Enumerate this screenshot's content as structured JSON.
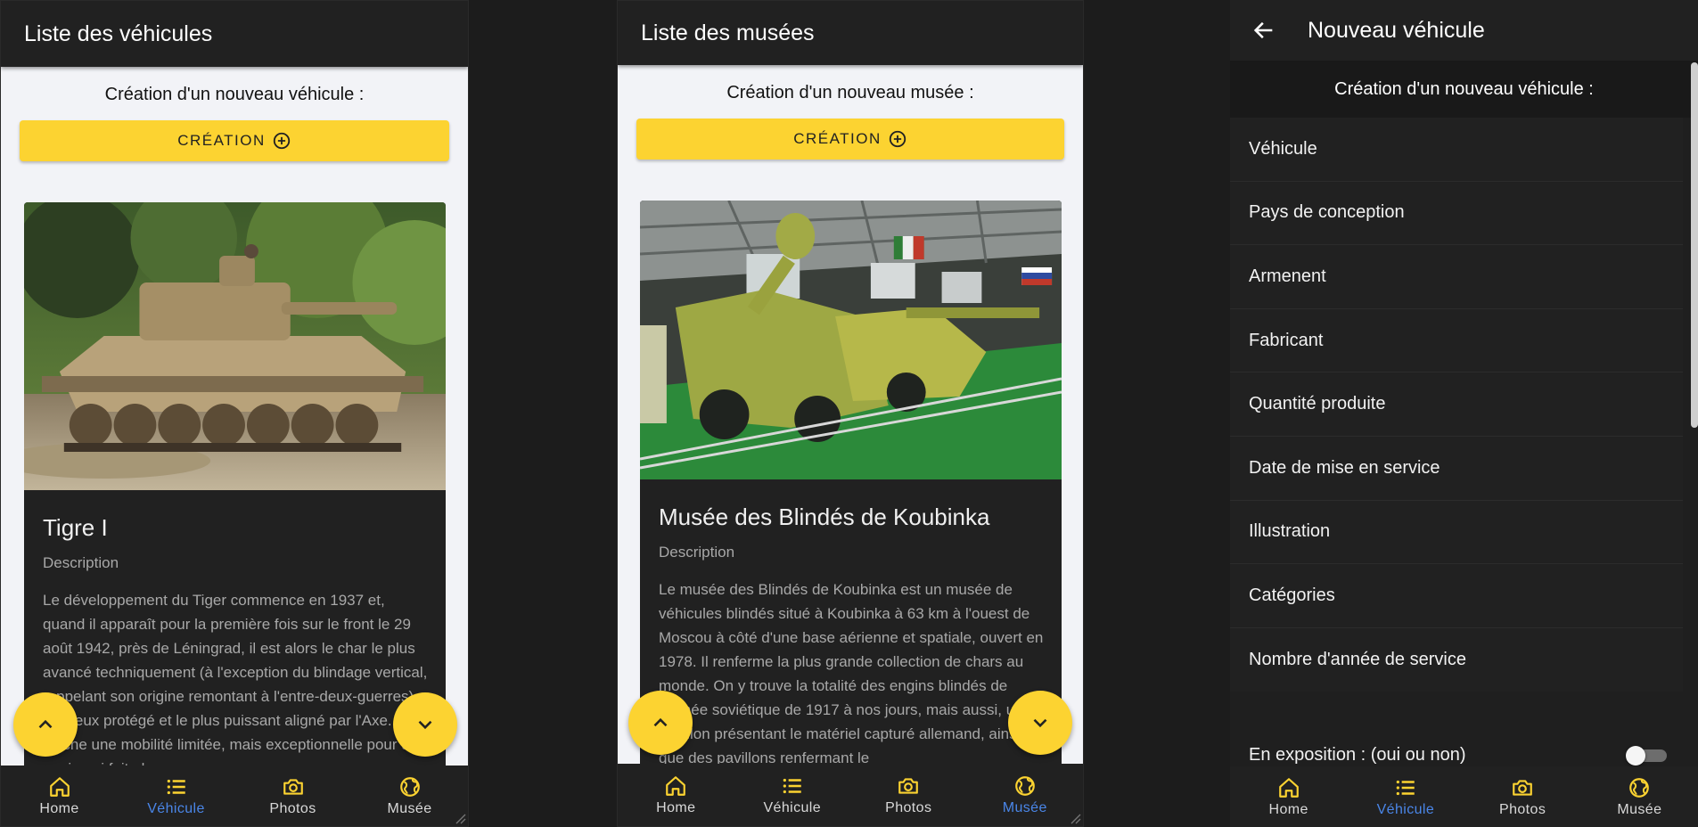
{
  "vehicles_screen": {
    "title": "Liste des véhicules",
    "subtitle": "Création d'un nouveau véhicule :",
    "create_label": "CRÉATION",
    "card": {
      "title": "Tigre I",
      "subtitle": "Description",
      "text": "Le développement du Tiger commence en 1937 et, quand il apparaît pour la première fois sur le front le 29 août 1942, près de Léningrad, il est alors le char le plus avancé techniquement (à l'exception du blindage vertical, rappelant son origine remontant à l'entre-deux-guerres), le mieux protégé et le plus puissant aligné par l'Axe. Il affiche une mobilité limitée, mais exceptionnelle pour un engin qui fait plus"
    }
  },
  "museums_screen": {
    "title": "Liste des musées",
    "subtitle": "Création d'un nouveau musée :",
    "create_label": "CRÉATION",
    "card": {
      "title": "Musée des Blindés de Koubinka",
      "subtitle": "Description",
      "text": "Le musée des Blindés de Koubinka est un musée de véhicules blindés situé à Koubinka à 63 km à l'ouest de Moscou à côté d'une base aérienne et spatiale, ouvert en 1978. Il renferme la plus grande collection de chars au monde. On y trouve la totalité des engins blindés de l'armée soviétique de 1917 à nos jours, mais aussi, un pavillon présentant le matériel capturé allemand, ainsi que des pavillons renfermant le"
    }
  },
  "new_vehicle_screen": {
    "title": "Nouveau véhicule",
    "subtitle": "Création d'un nouveau véhicule :",
    "fields": [
      "Véhicule",
      "Pays de conception",
      "Armenent",
      "Fabricant",
      "Quantité produite",
      "Date de mise en service",
      "Illustration",
      "Catégories",
      "Nombre d'année de service"
    ],
    "exhibition_label": "En exposition : (oui ou non)",
    "exhibition_value": false
  },
  "nav": {
    "home": "Home",
    "vehicle": "Véhicule",
    "photos": "Photos",
    "museum": "Musée"
  },
  "colors": {
    "accent": "#fcd331",
    "active_nav": "#4a86e8",
    "bar": "#212121"
  },
  "icons": {
    "home": "home-icon",
    "vehicle": "list-icon",
    "photos": "camera-icon",
    "museum": "globe-icon",
    "back": "arrow-left-icon",
    "create": "plus-circle-icon",
    "scroll_up": "chevron-up-icon",
    "scroll_down": "chevron-down-icon"
  }
}
